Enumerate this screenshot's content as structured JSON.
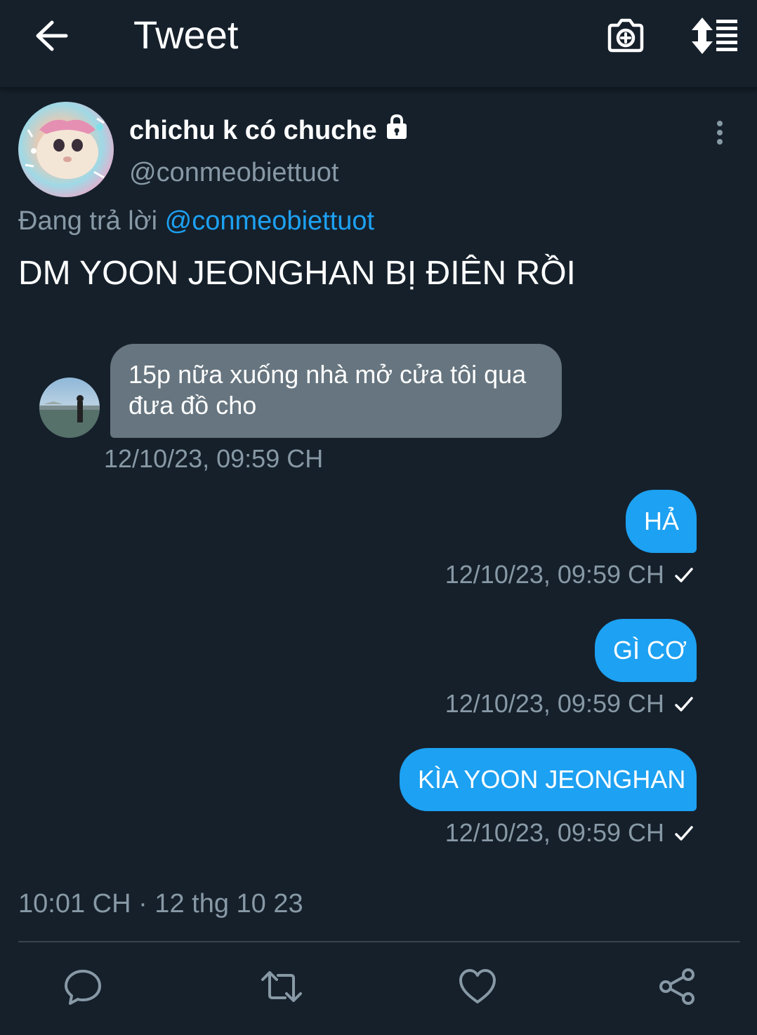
{
  "header": {
    "title": "Tweet"
  },
  "tweet": {
    "display_name": "chichu k có chuche",
    "handle": "@conmeobiettuot",
    "replying_prefix": "Đang trả lời",
    "replying_to": "@conmeobiettuot",
    "text": "DM YOON JEONGHAN BỊ ĐIÊN RỒI",
    "posted_at": "10:01 CH · 12 thg 10 23"
  },
  "conversation": {
    "incoming": {
      "text": "15p nữa xuống nhà mở cửa tôi qua đưa đồ cho",
      "time": "12/10/23, 09:59 CH"
    },
    "outgoing": [
      {
        "text": "HẢ",
        "time": "12/10/23, 09:59 CH"
      },
      {
        "text": "GÌ CƠ",
        "time": "12/10/23, 09:59 CH"
      },
      {
        "text": "KÌA YOON JEONGHAN",
        "time": "12/10/23, 09:59 CH"
      }
    ]
  },
  "icons": {
    "header": [
      "back-arrow-icon",
      "add-photo-camera-icon",
      "sort-list-icon"
    ],
    "actions": [
      "reply-icon",
      "retweet-icon",
      "like-icon",
      "share-icon"
    ]
  },
  "colors": {
    "background": "#15202b",
    "accent": "#1da1f2",
    "secondary_text": "#8899a6",
    "incoming_bubble": "#66757f"
  }
}
